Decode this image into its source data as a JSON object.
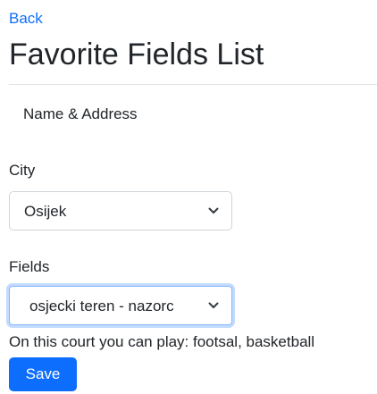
{
  "nav": {
    "back_label": "Back"
  },
  "page": {
    "title": "Favorite Fields List",
    "subheading": "Name & Address"
  },
  "city": {
    "label": "City",
    "selected": "Osijek"
  },
  "fields": {
    "label": "Fields",
    "selected": "osjecki teren - nazorc",
    "info": "On this court you can play: footsal, basketball"
  },
  "actions": {
    "save_label": "Save"
  },
  "colors": {
    "link": "#0d6efd",
    "primary_button": "#0d6efd",
    "focus_ring": "#86b7fe"
  },
  "icons": {
    "select_arrow": "chevron-down-icon"
  }
}
